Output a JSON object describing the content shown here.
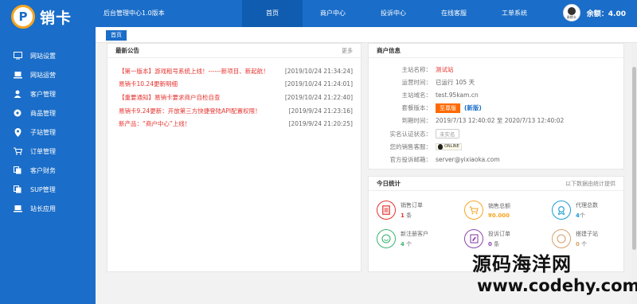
{
  "logo": {
    "mark": "P",
    "text": "销卡"
  },
  "sidebar": {
    "items": [
      {
        "label": "网站设置",
        "icon": "monitor-icon"
      },
      {
        "label": "网站运营",
        "icon": "laptop-icon"
      },
      {
        "label": "客户管理",
        "icon": "user-icon"
      },
      {
        "label": "商品管理",
        "icon": "circle-dot-icon"
      },
      {
        "label": "子站管理",
        "icon": "location-icon"
      },
      {
        "label": "订单管理",
        "icon": "cart-icon"
      },
      {
        "label": "客户财务",
        "icon": "copy-icon"
      },
      {
        "label": "SUP管理",
        "icon": "copy-icon"
      },
      {
        "label": "站长应用",
        "icon": "laptop-icon"
      }
    ]
  },
  "topbar": {
    "title": "后台管理中心1.0版本",
    "nav": [
      "首页",
      "商户中心",
      "投诉中心",
      "在线客服",
      "工单系统"
    ],
    "avatar_caption": "易销卡",
    "balance": "余额：4.00"
  },
  "breadcrumb": "首页",
  "notices": {
    "title": "最新公告",
    "more": "更多",
    "items": [
      {
        "text": "【第一版本】游戏租号系统上线！------新项目、新起航！",
        "date": "[2019/10/24 21:34:24]"
      },
      {
        "text": "易销卡10.24更新明细",
        "date": "[2019/10/24 21:24:01]"
      },
      {
        "text": "【重要通知】易销卡要求商户自检自查",
        "date": "[2019/10/24 21:22:40]"
      },
      {
        "text": "易销卡9.24更新：开放第三方快捷登陆API配置权限！",
        "date": "[2019/9/24 21:23:16]"
      },
      {
        "text": "新产品：“商户中心”上线！",
        "date": "[2019/9/24 21:20:25]"
      }
    ]
  },
  "merchant": {
    "title": "商户信息",
    "site_name_label": "主站名称：",
    "site_name": "测试站",
    "run_time_label": "运营时间：",
    "run_time": "已运行 105 天",
    "domain_label": "主站域名：",
    "domain": "test.95kam.cn",
    "version_label": "套餐版本：",
    "version_button": "至尊版",
    "version_link": "(新版)",
    "expire_label": "到期时间：",
    "expire": "2019/7/13 12:40:02 至 2020/7/13 12:40:02",
    "verify_label": "实名认证状态：",
    "verify": "未实名",
    "service_label": "您的销售客服：",
    "service_badge": "ONLINE",
    "email_label": "官方投诉邮箱：",
    "email": "server@yixiaoka.com"
  },
  "stats": {
    "title": "今日统计",
    "note": "以下数据由统计提供",
    "items": [
      {
        "label": "销售订单",
        "value": "1",
        "unit": "条",
        "icon": "document-icon",
        "color": "#e5322d"
      },
      {
        "label": "销售总额",
        "value": "¥0.000",
        "unit": "",
        "icon": "cart-icon",
        "color": "#f5a623"
      },
      {
        "label": "代理总数",
        "value": "4",
        "unit": "个",
        "icon": "badge-icon",
        "color": "#1a9bd7"
      },
      {
        "label": "新注册客户",
        "value": "4",
        "unit": "个",
        "icon": "smile-user-icon",
        "color": "#3cb371"
      },
      {
        "label": "投诉订单",
        "value": "0",
        "unit": "条",
        "icon": "complaint-icon",
        "color": "#8e44ad"
      },
      {
        "label": "搭建子站",
        "value": "0",
        "unit": "个",
        "icon": "sub-site-icon",
        "color": "#d9a06b"
      }
    ]
  },
  "watermark": {
    "line1": "源码海洋网",
    "line2": "www.codehy.com"
  }
}
